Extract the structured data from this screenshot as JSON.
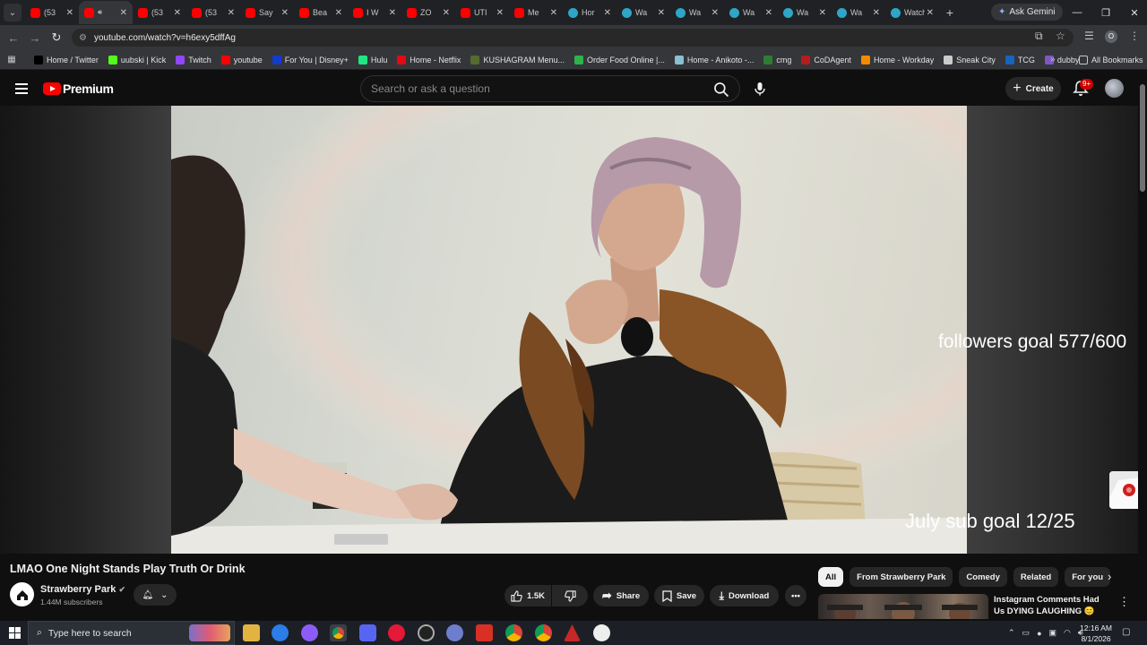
{
  "browser": {
    "tabs": [
      {
        "title": "(53",
        "icon": "youtube"
      },
      {
        "title": "",
        "icon": "youtube",
        "active": true,
        "audio": true
      },
      {
        "title": "(53",
        "icon": "youtube"
      },
      {
        "title": "(53",
        "icon": "youtube"
      },
      {
        "title": "Say",
        "icon": "youtube"
      },
      {
        "title": "Bea",
        "icon": "youtube"
      },
      {
        "title": "I W",
        "icon": "youtube"
      },
      {
        "title": "ZO",
        "icon": "youtube"
      },
      {
        "title": "UTI",
        "icon": "youtube"
      },
      {
        "title": "Me",
        "icon": "youtube"
      },
      {
        "title": "Hor",
        "icon": "web"
      },
      {
        "title": "Wa",
        "icon": "web"
      },
      {
        "title": "Wa",
        "icon": "web"
      },
      {
        "title": "Wa",
        "icon": "web"
      },
      {
        "title": "Wa",
        "icon": "web"
      },
      {
        "title": "Wa",
        "icon": "web"
      },
      {
        "title": "Watch T",
        "icon": "web"
      }
    ],
    "new_tab": "+",
    "ask_gemini": "Ask Gemini",
    "url": "youtube.com/watch?v=h6exy5dffAg",
    "profile_initial": "O",
    "bookmarks": [
      {
        "label": "Home / Twitter",
        "color": "#000000"
      },
      {
        "label": "uubski | Kick",
        "color": "#53fc18"
      },
      {
        "label": "Twitch",
        "color": "#9146ff"
      },
      {
        "label": "youtube",
        "color": "#ff0000"
      },
      {
        "label": "For You | Disney+",
        "color": "#113ccf"
      },
      {
        "label": "Hulu",
        "color": "#1ce783"
      },
      {
        "label": "Home - Netflix",
        "color": "#e50914"
      },
      {
        "label": "KUSHAGRAM Menu...",
        "color": "#556b2f"
      },
      {
        "label": "Order Food Online |...",
        "color": "#2db34a"
      },
      {
        "label": "Home - Anikoto -...",
        "color": "#88c0d0"
      },
      {
        "label": "cmg",
        "color": "#2e7d32"
      },
      {
        "label": "CoDAgent",
        "color": "#b71c1c"
      },
      {
        "label": "Home - Workday",
        "color": "#f38b00"
      },
      {
        "label": "Sneak City",
        "color": "#cccccc"
      },
      {
        "label": "TCG",
        "color": "#1565c0"
      },
      {
        "label": "dubby",
        "color": "#7e57c2"
      }
    ],
    "all_bookmarks": "All Bookmarks"
  },
  "youtube": {
    "logo_text": "Premium",
    "search_placeholder": "Search or ask a question",
    "create_label": "Create",
    "notifications_badge": "9+"
  },
  "video": {
    "overlay_followers": "followers goal 577/600",
    "overlay_subs": "July sub goal 12/25",
    "title": "LMAO One Night Stands Play Truth Or Drink",
    "channel": "Strawberry Park",
    "subscribers": "1.44M subscribers",
    "likes": "1.5K",
    "share_label": "Share",
    "save_label": "Save",
    "download_label": "Download"
  },
  "sidebar": {
    "chips": [
      "All",
      "From Strawberry Park",
      "Comedy",
      "Related",
      "For you"
    ],
    "recommendation_title": "Instagram Comments Had Us DYING LAUGHING 😊"
  },
  "taskbar": {
    "search_placeholder": "Type here to search",
    "time": "12:16 AM",
    "date": "8/1/2026"
  },
  "colors": {
    "youtube_red": "#ff0000",
    "page_bg": "#0f0f0f",
    "chrome_bg": "#35363a"
  }
}
